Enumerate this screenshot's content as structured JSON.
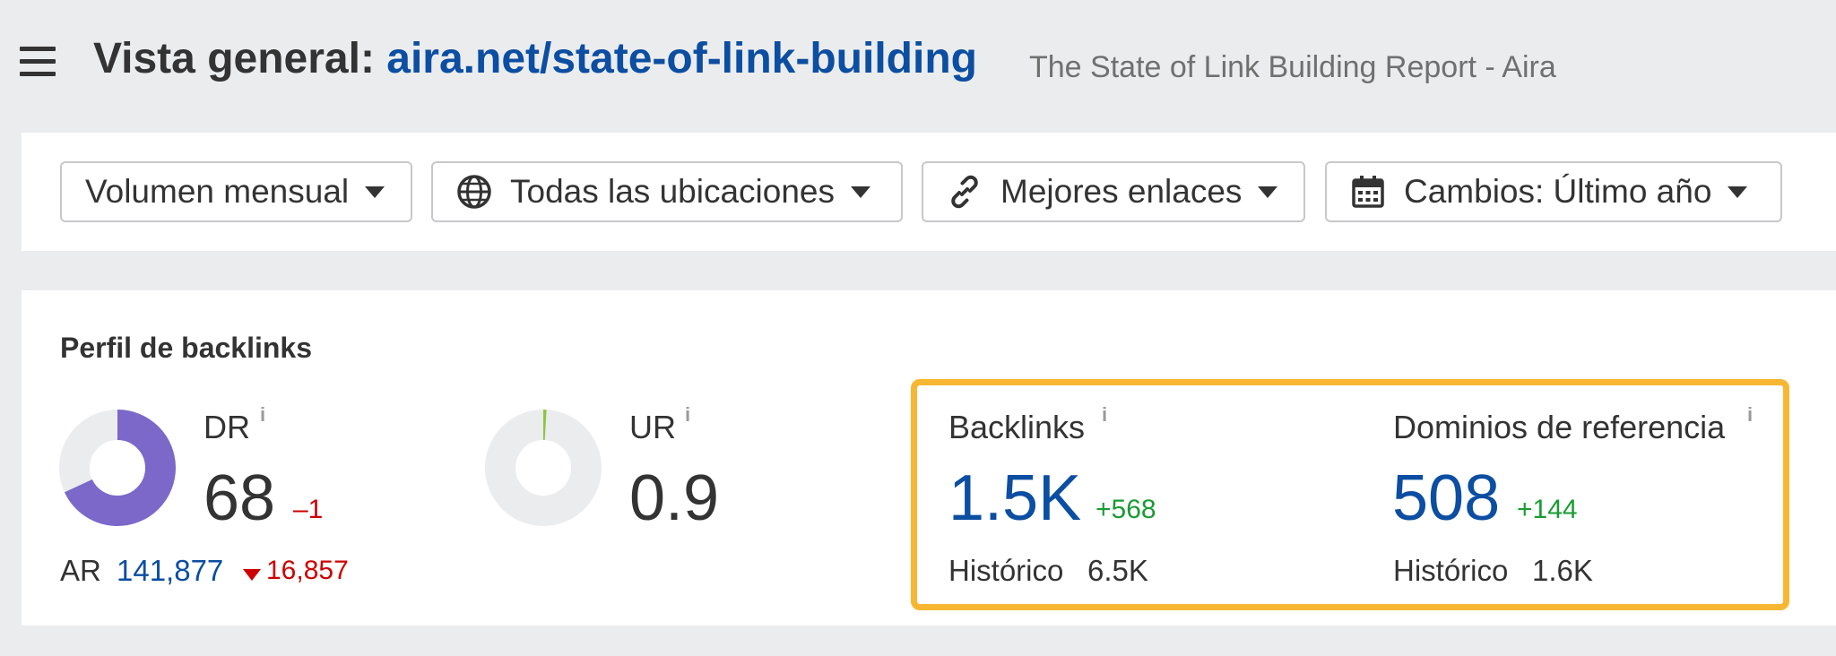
{
  "header": {
    "title_prefix": "Vista general:",
    "url": "aira.net/state-of-link-building",
    "page_title": "The State of Link Building Report - Aira"
  },
  "filters": {
    "volume": "Volumen mensual",
    "locations": "Todas las ubicaciones",
    "links": "Mejores enlaces",
    "changes": "Cambios: Último año"
  },
  "profile": {
    "section_title": "Perfil de backlinks",
    "dr": {
      "label": "DR",
      "info": "i",
      "value": "68",
      "delta": "–1",
      "fill_fraction": 0.68
    },
    "ar": {
      "label": "AR",
      "value": "141,877",
      "delta": "16,857"
    },
    "ur": {
      "label": "UR",
      "info": "i",
      "value": "0.9",
      "fill_fraction": 0.009
    },
    "backlinks": {
      "label": "Backlinks",
      "info": "i",
      "value": "1.5K",
      "delta": "+568",
      "historic_label": "Histórico",
      "historic_value": "6.5K"
    },
    "domains": {
      "label": "Dominios de referencia",
      "info": "i",
      "value": "508",
      "delta": "+144",
      "historic_label": "Histórico",
      "historic_value": "1.6K"
    }
  },
  "colors": {
    "dr_ring": "#7b68c9",
    "ur_ring": "#8cc63f",
    "ring_track": "#ebecee",
    "highlight": "#f7b733",
    "link_blue": "#0b4ea2",
    "negative": "#cc0000",
    "positive": "#1a9b33"
  },
  "icons": {
    "menu": "hamburger-menu-icon",
    "locations": "globe-icon",
    "links": "link-icon",
    "changes": "calendar-icon",
    "dropdown": "caret-down-icon"
  }
}
